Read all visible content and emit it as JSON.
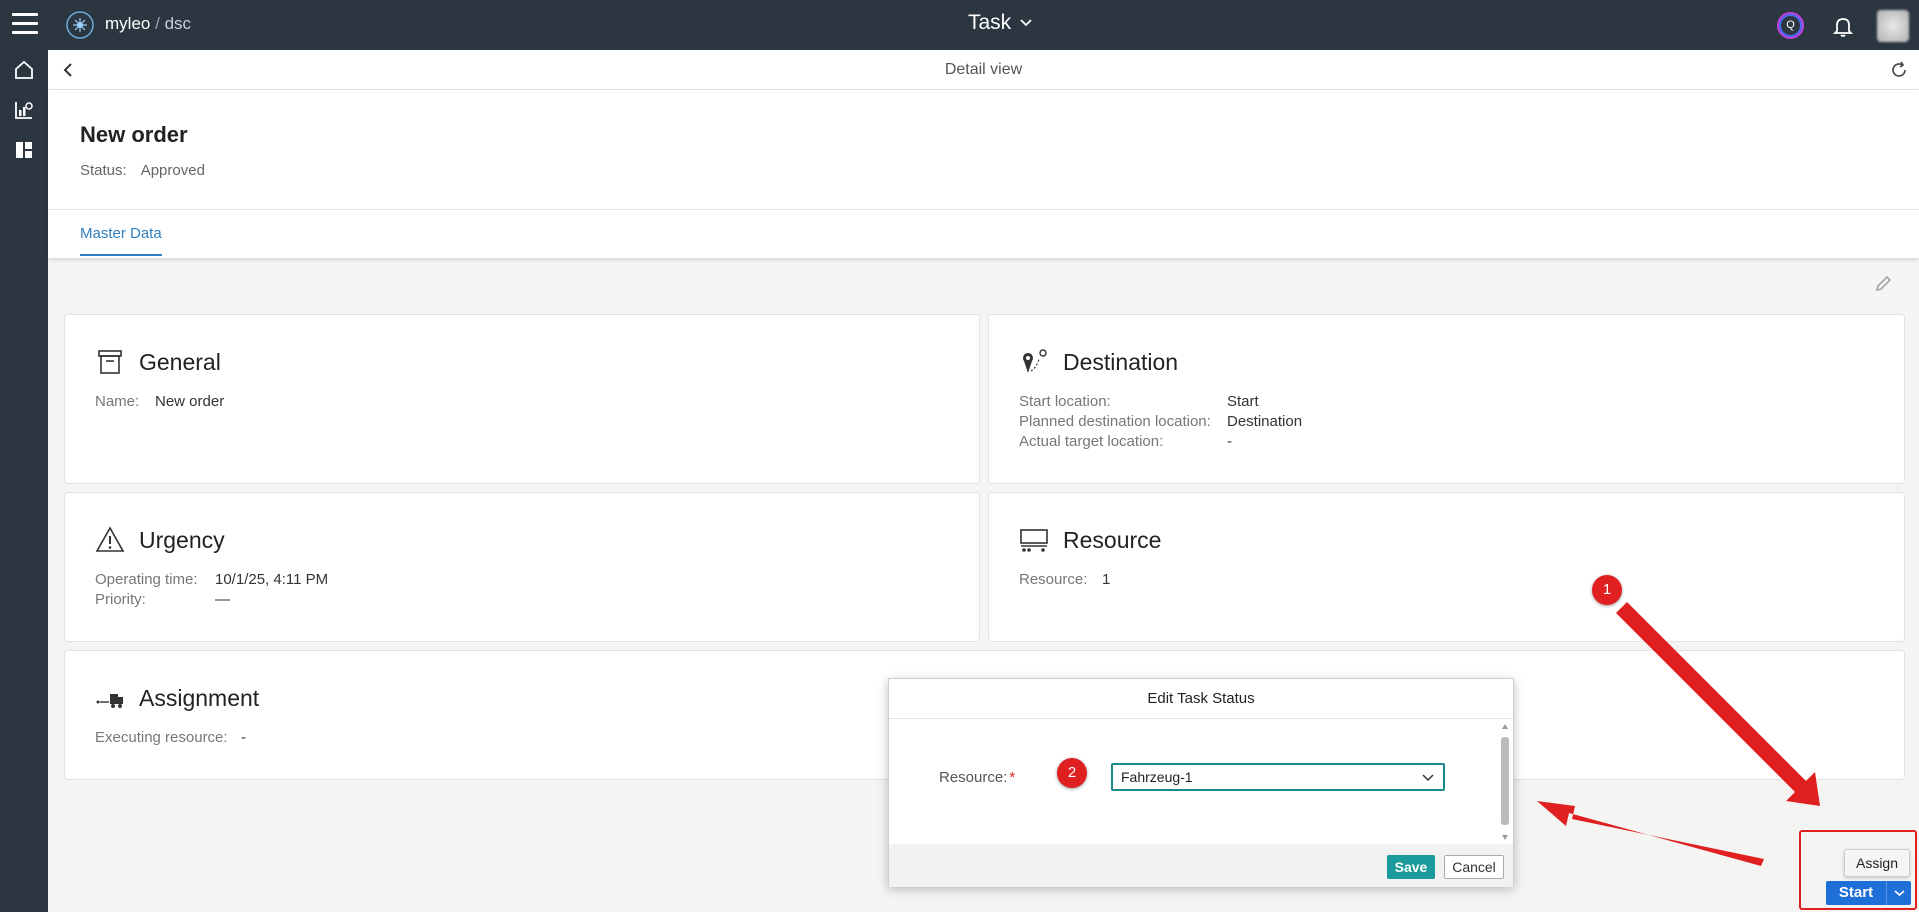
{
  "app": {
    "brand": "myleo",
    "brand_separator": "/",
    "brand_sub": "dsc",
    "page_selector": "Task",
    "avatar_letter": "Q"
  },
  "subheader": {
    "title": "Detail view"
  },
  "order": {
    "title": "New order",
    "status_label": "Status:",
    "status_value": "Approved",
    "tab": "Master Data"
  },
  "cards": {
    "general": {
      "title": "General",
      "icon": "archive-box-icon",
      "name_label": "Name:",
      "name_value": "New order"
    },
    "destination": {
      "title": "Destination",
      "icon": "route-pin-icon",
      "rows": [
        {
          "label": "Start location:",
          "value": "Start"
        },
        {
          "label": "Planned destination location:",
          "value": "Destination"
        },
        {
          "label": "Actual target location:",
          "value": "-"
        }
      ]
    },
    "urgency": {
      "title": "Urgency",
      "icon": "warning-triangle-icon",
      "rows": [
        {
          "label": "Operating time:",
          "value": "10/1/25, 4:11 PM"
        },
        {
          "label": "Priority:",
          "value": "—"
        }
      ]
    },
    "resource": {
      "title": "Resource",
      "icon": "vehicle-icon",
      "label": "Resource:",
      "value": "1"
    },
    "assignment": {
      "title": "Assignment",
      "icon": "truck-assign-icon",
      "label": "Executing resource:",
      "value": "-"
    }
  },
  "dialog": {
    "title": "Edit Task Status",
    "field_label": "Resource:",
    "required_mark": "*",
    "selected_value": "Fahrzeug-1",
    "save_label": "Save",
    "cancel_label": "Cancel"
  },
  "markers": {
    "one": "1",
    "two": "2"
  },
  "actions": {
    "assign_label": "Assign",
    "start_label": "Start"
  },
  "colors": {
    "topbar": "#2b3641",
    "accent_blue": "#2f7fc1",
    "save_teal": "#1a9a9a",
    "start_blue": "#1e6fd8",
    "annotation_red": "#e02020"
  }
}
